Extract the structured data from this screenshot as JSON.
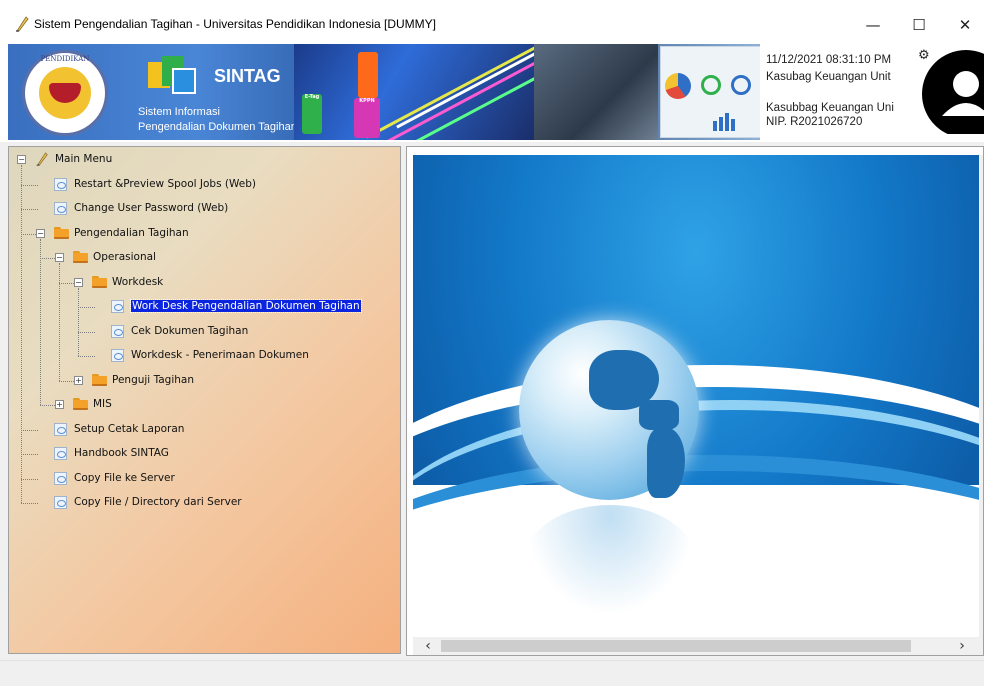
{
  "window": {
    "title": "Sistem Pengendalian Tagihan - Universitas Pendidikan Indonesia [DUMMY]",
    "minimize_glyph": "—",
    "maximize_glyph": "☐",
    "close_glyph": "✕"
  },
  "banner": {
    "seal_text": "PENDIDIKAN",
    "app_name": "SINTAG",
    "subtitle_line1": "Sistem Informasi",
    "subtitle_line2": "Pengendalian Dokumen Tagihan",
    "tag_labels": [
      "KPPN",
      "E-Tag"
    ]
  },
  "user_info": {
    "datetime": "11/12/2021 08:31:10 PM",
    "role": "Kasubag Keuangan Unit",
    "name": "Kasubbag Keuangan Uni",
    "nip": "NIP. R2021026720",
    "gear_icon": "gear-icon",
    "avatar_icon": "user-avatar-icon"
  },
  "tree": {
    "items": [
      {
        "label": "Main Menu",
        "icon": "quill-icon",
        "toggle": "−",
        "level": 0
      },
      {
        "label": "Restart &Preview Spool Jobs (Web)",
        "icon": "document-icon",
        "level": 1
      },
      {
        "label": "Change User Password (Web)",
        "icon": "document-icon",
        "level": 1
      },
      {
        "label": "Pengendalian Tagihan",
        "icon": "folder-icon",
        "toggle": "−",
        "level": 1
      },
      {
        "label": "Operasional",
        "icon": "folder-icon",
        "toggle": "−",
        "level": 2
      },
      {
        "label": "Workdesk",
        "icon": "folder-icon",
        "toggle": "−",
        "level": 3
      },
      {
        "label": "Work Desk Pengendalian Dokumen Tagihan",
        "icon": "document-icon",
        "level": 4,
        "selected": true
      },
      {
        "label": "Cek Dokumen Tagihan",
        "icon": "document-icon",
        "level": 4
      },
      {
        "label": "Workdesk - Penerimaan Dokumen",
        "icon": "document-icon",
        "level": 4
      },
      {
        "label": "Penguji Tagihan",
        "icon": "folder-icon",
        "toggle": "+",
        "level": 3
      },
      {
        "label": "MIS",
        "icon": "folder-icon",
        "toggle": "+",
        "level": 2
      },
      {
        "label": "Setup Cetak Laporan",
        "icon": "document-icon",
        "level": 1
      },
      {
        "label": "Handbook SINTAG",
        "icon": "document-icon",
        "level": 1
      },
      {
        "label": "Copy File ke Server",
        "icon": "document-icon",
        "level": 1
      },
      {
        "label": "Copy File / Directory dari Server",
        "icon": "document-icon",
        "level": 1
      }
    ]
  },
  "image_panel": {
    "scroll_left_glyph": "‹",
    "scroll_right_glyph": "›"
  },
  "colors": {
    "selection": "#0a24e0",
    "folder": "#f4a12a",
    "sky_blue": "#1379c9"
  }
}
